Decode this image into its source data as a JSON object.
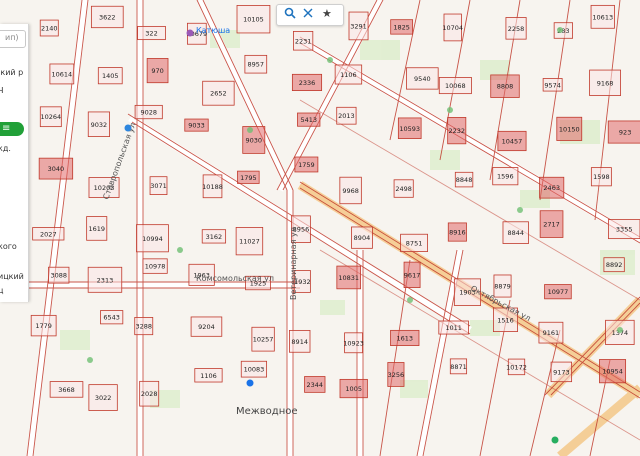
{
  "map": {
    "streets": [
      {
        "name": "Ставропольская ул"
      },
      {
        "name": "Комсомольская ул"
      },
      {
        "name": "Ветеринарная ул"
      },
      {
        "name": "Октябрьская ул"
      }
    ],
    "places": [
      {
        "name": "Межводное"
      },
      {
        "name": "Катюша"
      }
    ],
    "parcels": [
      {
        "n": "2140"
      },
      {
        "n": "3622"
      },
      {
        "n": "322"
      },
      {
        "n": "10679"
      },
      {
        "n": "10105"
      },
      {
        "n": "2231"
      },
      {
        "n": "3291"
      },
      {
        "n": "1825"
      },
      {
        "n": "10704"
      },
      {
        "n": "2258"
      },
      {
        "n": "283"
      },
      {
        "n": "10613"
      },
      {
        "n": "10614"
      },
      {
        "n": "1405"
      },
      {
        "n": "970"
      },
      {
        "n": "2652"
      },
      {
        "n": "8957"
      },
      {
        "n": "2336"
      },
      {
        "n": "1106"
      },
      {
        "n": "9540"
      },
      {
        "n": "10068"
      },
      {
        "n": "8808"
      },
      {
        "n": "9574"
      },
      {
        "n": "9168"
      },
      {
        "n": "10264"
      },
      {
        "n": "9032"
      },
      {
        "n": "9028"
      },
      {
        "n": "9033"
      },
      {
        "n": "9030"
      },
      {
        "n": "5413"
      },
      {
        "n": "2013"
      },
      {
        "n": "10593"
      },
      {
        "n": "2232"
      },
      {
        "n": "10457"
      },
      {
        "n": "10150"
      },
      {
        "n": "923"
      },
      {
        "n": "3040"
      },
      {
        "n": "10203"
      },
      {
        "n": "3071"
      },
      {
        "n": "10188"
      },
      {
        "n": "1795"
      },
      {
        "n": "1759"
      },
      {
        "n": "9968"
      },
      {
        "n": "2498"
      },
      {
        "n": "8848"
      },
      {
        "n": "1596"
      },
      {
        "n": "2463"
      },
      {
        "n": "1598"
      },
      {
        "n": "2027"
      },
      {
        "n": "1619"
      },
      {
        "n": "10994"
      },
      {
        "n": "3162"
      },
      {
        "n": "11027"
      },
      {
        "n": "8956"
      },
      {
        "n": "8904"
      },
      {
        "n": "8751"
      },
      {
        "n": "8916"
      },
      {
        "n": "8844"
      },
      {
        "n": "2717"
      },
      {
        "n": "3355"
      },
      {
        "n": "3088"
      },
      {
        "n": "2313"
      },
      {
        "n": "10978"
      },
      {
        "n": "1963"
      },
      {
        "n": "1925"
      },
      {
        "n": "1932"
      },
      {
        "n": "10831"
      },
      {
        "n": "9617"
      },
      {
        "n": "1903"
      },
      {
        "n": "8879"
      },
      {
        "n": "10977"
      },
      {
        "n": "8892"
      },
      {
        "n": "1779"
      },
      {
        "n": "6543"
      },
      {
        "n": "3288"
      },
      {
        "n": "9204"
      },
      {
        "n": "10257"
      },
      {
        "n": "8914"
      },
      {
        "n": "10923"
      },
      {
        "n": "1613"
      },
      {
        "n": "1011"
      },
      {
        "n": "1516"
      },
      {
        "n": "9161"
      },
      {
        "n": "1374"
      },
      {
        "n": "3668"
      },
      {
        "n": "3022"
      },
      {
        "n": "2028"
      },
      {
        "n": "1106"
      },
      {
        "n": "10083"
      },
      {
        "n": "2344"
      },
      {
        "n": "1005"
      },
      {
        "n": "3256"
      },
      {
        "n": "8871"
      },
      {
        "n": "10172"
      },
      {
        "n": "9173"
      },
      {
        "n": "10954"
      }
    ]
  },
  "panel": {
    "search_placeholder": "ип)",
    "lines": [
      "ский р",
      "Ч",
      "кд.",
      "кого",
      "ицкий",
      "ц"
    ],
    "button_label": "≡"
  },
  "topbar": {
    "search_icon": "search-icon",
    "close_icon": "close-icon",
    "star_icon": "star-icon"
  }
}
